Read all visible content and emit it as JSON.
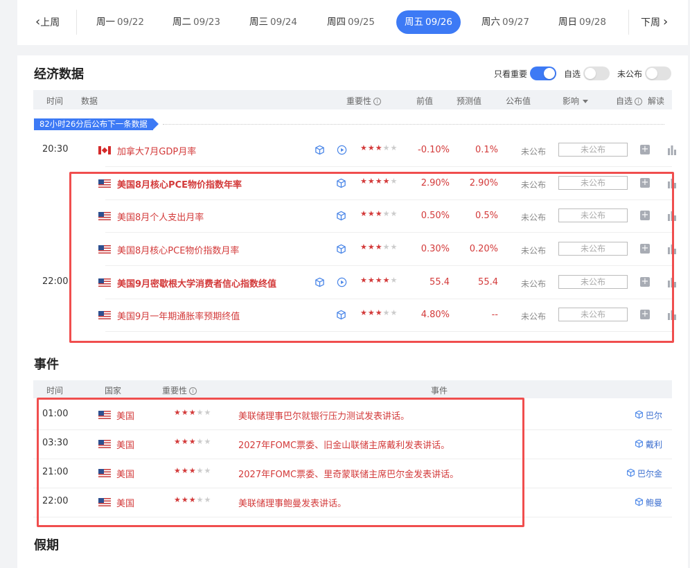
{
  "nav": {
    "prev_label": "上周",
    "next_label": "下周",
    "days": [
      {
        "weekday": "周一",
        "date": "09/22",
        "active": false
      },
      {
        "weekday": "周二",
        "date": "09/23",
        "active": false
      },
      {
        "weekday": "周三",
        "date": "09/24",
        "active": false
      },
      {
        "weekday": "周四",
        "date": "09/25",
        "active": false
      },
      {
        "weekday": "周五",
        "date": "09/26",
        "active": true
      },
      {
        "weekday": "周六",
        "date": "09/27",
        "active": false
      },
      {
        "weekday": "周日",
        "date": "09/28",
        "active": false
      }
    ]
  },
  "economic": {
    "title": "经济数据",
    "filters": {
      "important_label": "只看重要",
      "important_on": true,
      "watch_label": "自选",
      "watch_on": false,
      "unpublished_label": "未公布",
      "unpublished_on": false
    },
    "headers": {
      "time": "时间",
      "data": "数据",
      "importance": "重要性",
      "prev": "前值",
      "forecast": "预测值",
      "actual": "公布值",
      "impact": "影响",
      "watch": "自选",
      "interpret": "解读"
    },
    "banner": "82小时26分后公布下一条数据",
    "rows": [
      {
        "time": "20:30",
        "country": "ca",
        "name": "加拿大7月GDP月率",
        "bold": false,
        "cube": true,
        "play": true,
        "stars": 3,
        "prev": "-0.10%",
        "forecast": "0.1%",
        "actual": "未公布",
        "impact": "未公布"
      },
      {
        "time": "",
        "country": "us",
        "name": "美国8月核心PCE物价指数年率",
        "bold": true,
        "cube": true,
        "play": false,
        "stars": 4,
        "prev": "2.90%",
        "forecast": "2.90%",
        "actual": "未公布",
        "impact": "未公布"
      },
      {
        "time": "",
        "country": "us",
        "name": "美国8月个人支出月率",
        "bold": false,
        "cube": true,
        "play": false,
        "stars": 3,
        "prev": "0.50%",
        "forecast": "0.5%",
        "actual": "未公布",
        "impact": "未公布"
      },
      {
        "time": "",
        "country": "us",
        "name": "美国8月核心PCE物价指数月率",
        "bold": false,
        "cube": true,
        "play": false,
        "stars": 3,
        "prev": "0.30%",
        "forecast": "0.20%",
        "actual": "未公布",
        "impact": "未公布"
      },
      {
        "time": "22:00",
        "country": "us",
        "name": "美国9月密歇根大学消费者信心指数终值",
        "bold": true,
        "cube": true,
        "play": true,
        "stars": 4,
        "prev": "55.4",
        "forecast": "55.4",
        "actual": "未公布",
        "impact": "未公布"
      },
      {
        "time": "",
        "country": "us",
        "name": "美国9月一年期通胀率预期终值",
        "bold": false,
        "cube": true,
        "play": false,
        "stars": 3,
        "prev": "4.80%",
        "forecast": "--",
        "actual": "未公布",
        "impact": "未公布"
      }
    ]
  },
  "events": {
    "title": "事件",
    "headers": {
      "time": "时间",
      "country": "国家",
      "importance": "重要性",
      "event": "事件"
    },
    "rows": [
      {
        "time": "01:00",
        "country": "美国",
        "stars": 3,
        "event": "美联储理事巴尔就银行压力测试发表讲话。",
        "person": "巴尔"
      },
      {
        "time": "03:30",
        "country": "美国",
        "stars": 3,
        "event": "2027年FOMC票委、旧金山联储主席戴利发表讲话。",
        "person": "戴利"
      },
      {
        "time": "21:00",
        "country": "美国",
        "stars": 3,
        "event": "2027年FOMC票委、里奇蒙联储主席巴尔金发表讲话。",
        "person": "巴尔金"
      },
      {
        "time": "22:00",
        "country": "美国",
        "stars": 3,
        "event": "美联储理事鲍曼发表讲话。",
        "person": "鲍曼"
      }
    ]
  },
  "holidays": {
    "title": "假期"
  },
  "colors": {
    "accent": "#3d7af5",
    "red": "#d33a3a",
    "highlight": "#f04e4e"
  }
}
